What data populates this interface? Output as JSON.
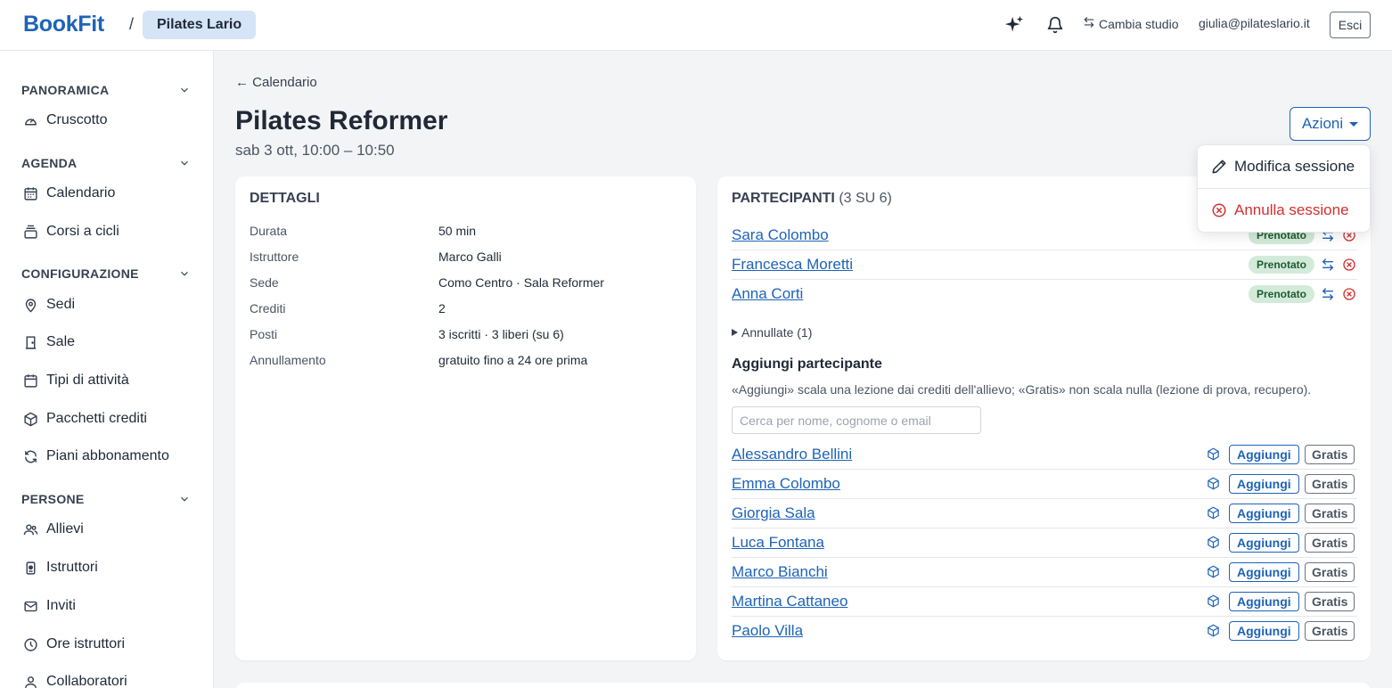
{
  "header": {
    "brand": "BookFit",
    "separator": "/",
    "studio": "Pilates Lario",
    "switch_studio": "Cambia studio",
    "user_email": "giulia@pilateslario.it",
    "logout": "Esci"
  },
  "sidebar": {
    "sections": [
      {
        "title": "PANORAMICA",
        "items": [
          {
            "label": "Cruscotto",
            "icon": "gauge-icon"
          }
        ]
      },
      {
        "title": "AGENDA",
        "items": [
          {
            "label": "Calendario",
            "icon": "calendar-icon"
          },
          {
            "label": "Corsi a cicli",
            "icon": "stack-icon"
          }
        ]
      },
      {
        "title": "CONFIGURAZIONE",
        "items": [
          {
            "label": "Sedi",
            "icon": "map-pin-icon"
          },
          {
            "label": "Sale",
            "icon": "door-icon"
          },
          {
            "label": "Tipi di attività",
            "icon": "calendar-icon"
          },
          {
            "label": "Pacchetti crediti",
            "icon": "package-icon"
          },
          {
            "label": "Piani abbonamento",
            "icon": "refresh-icon"
          }
        ]
      },
      {
        "title": "PERSONE",
        "items": [
          {
            "label": "Allievi",
            "icon": "users-icon"
          },
          {
            "label": "Istruttori",
            "icon": "badge-icon"
          },
          {
            "label": "Inviti",
            "icon": "mail-icon"
          },
          {
            "label": "Ore istruttori",
            "icon": "clock-icon"
          },
          {
            "label": "Collaboratori",
            "icon": "user-icon"
          }
        ]
      }
    ]
  },
  "session": {
    "back": "← Calendario",
    "title": "Pilates Reformer",
    "subtitle": "sab 3 ott, 10:00 – 10:50",
    "actions_label": "Azioni"
  },
  "actions_menu": {
    "edit": "Modifica sessione",
    "cancel": "Annulla sessione"
  },
  "details": {
    "title": "DETTAGLI",
    "rows": [
      {
        "label": "Durata",
        "value": "50 min"
      },
      {
        "label": "Istruttore",
        "value": "Marco Galli"
      },
      {
        "label": "Sede",
        "value": "Como Centro · Sala Reformer"
      },
      {
        "label": "Crediti",
        "value": "2"
      },
      {
        "label": "Posti",
        "value": "3 iscritti · 3 liberi (su 6)"
      },
      {
        "label": "Annullamento",
        "value": "gratuito fino a 24 ore prima"
      }
    ]
  },
  "participants": {
    "title": "PARTECIPANTI",
    "count": "(3 SU 6)",
    "list": [
      {
        "name": "Sara Colombo",
        "status": "Prenotato"
      },
      {
        "name": "Francesca Moretti",
        "status": "Prenotato"
      },
      {
        "name": "Anna Corti",
        "status": "Prenotato"
      }
    ],
    "cancelled": "Annullate (1)",
    "add_title": "Aggiungi partecipante",
    "add_help": "«Aggiungi» scala una lezione dai crediti dell'allievo; «Gratis» non scala nulla (lezione di prova, recupero).",
    "search_placeholder": "Cerca per nome, cognome o email",
    "add_label": "Aggiungi",
    "free_label": "Gratis",
    "candidates": [
      "Alessandro Bellini",
      "Emma Colombo",
      "Giorgia Sala",
      "Luca Fontana",
      "Marco Bianchi",
      "Martina Cattaneo",
      "Paolo Villa"
    ]
  },
  "colors": {
    "brand": "#1e63b8",
    "danger": "#d32f2f",
    "success_bg": "#d3ead9"
  }
}
